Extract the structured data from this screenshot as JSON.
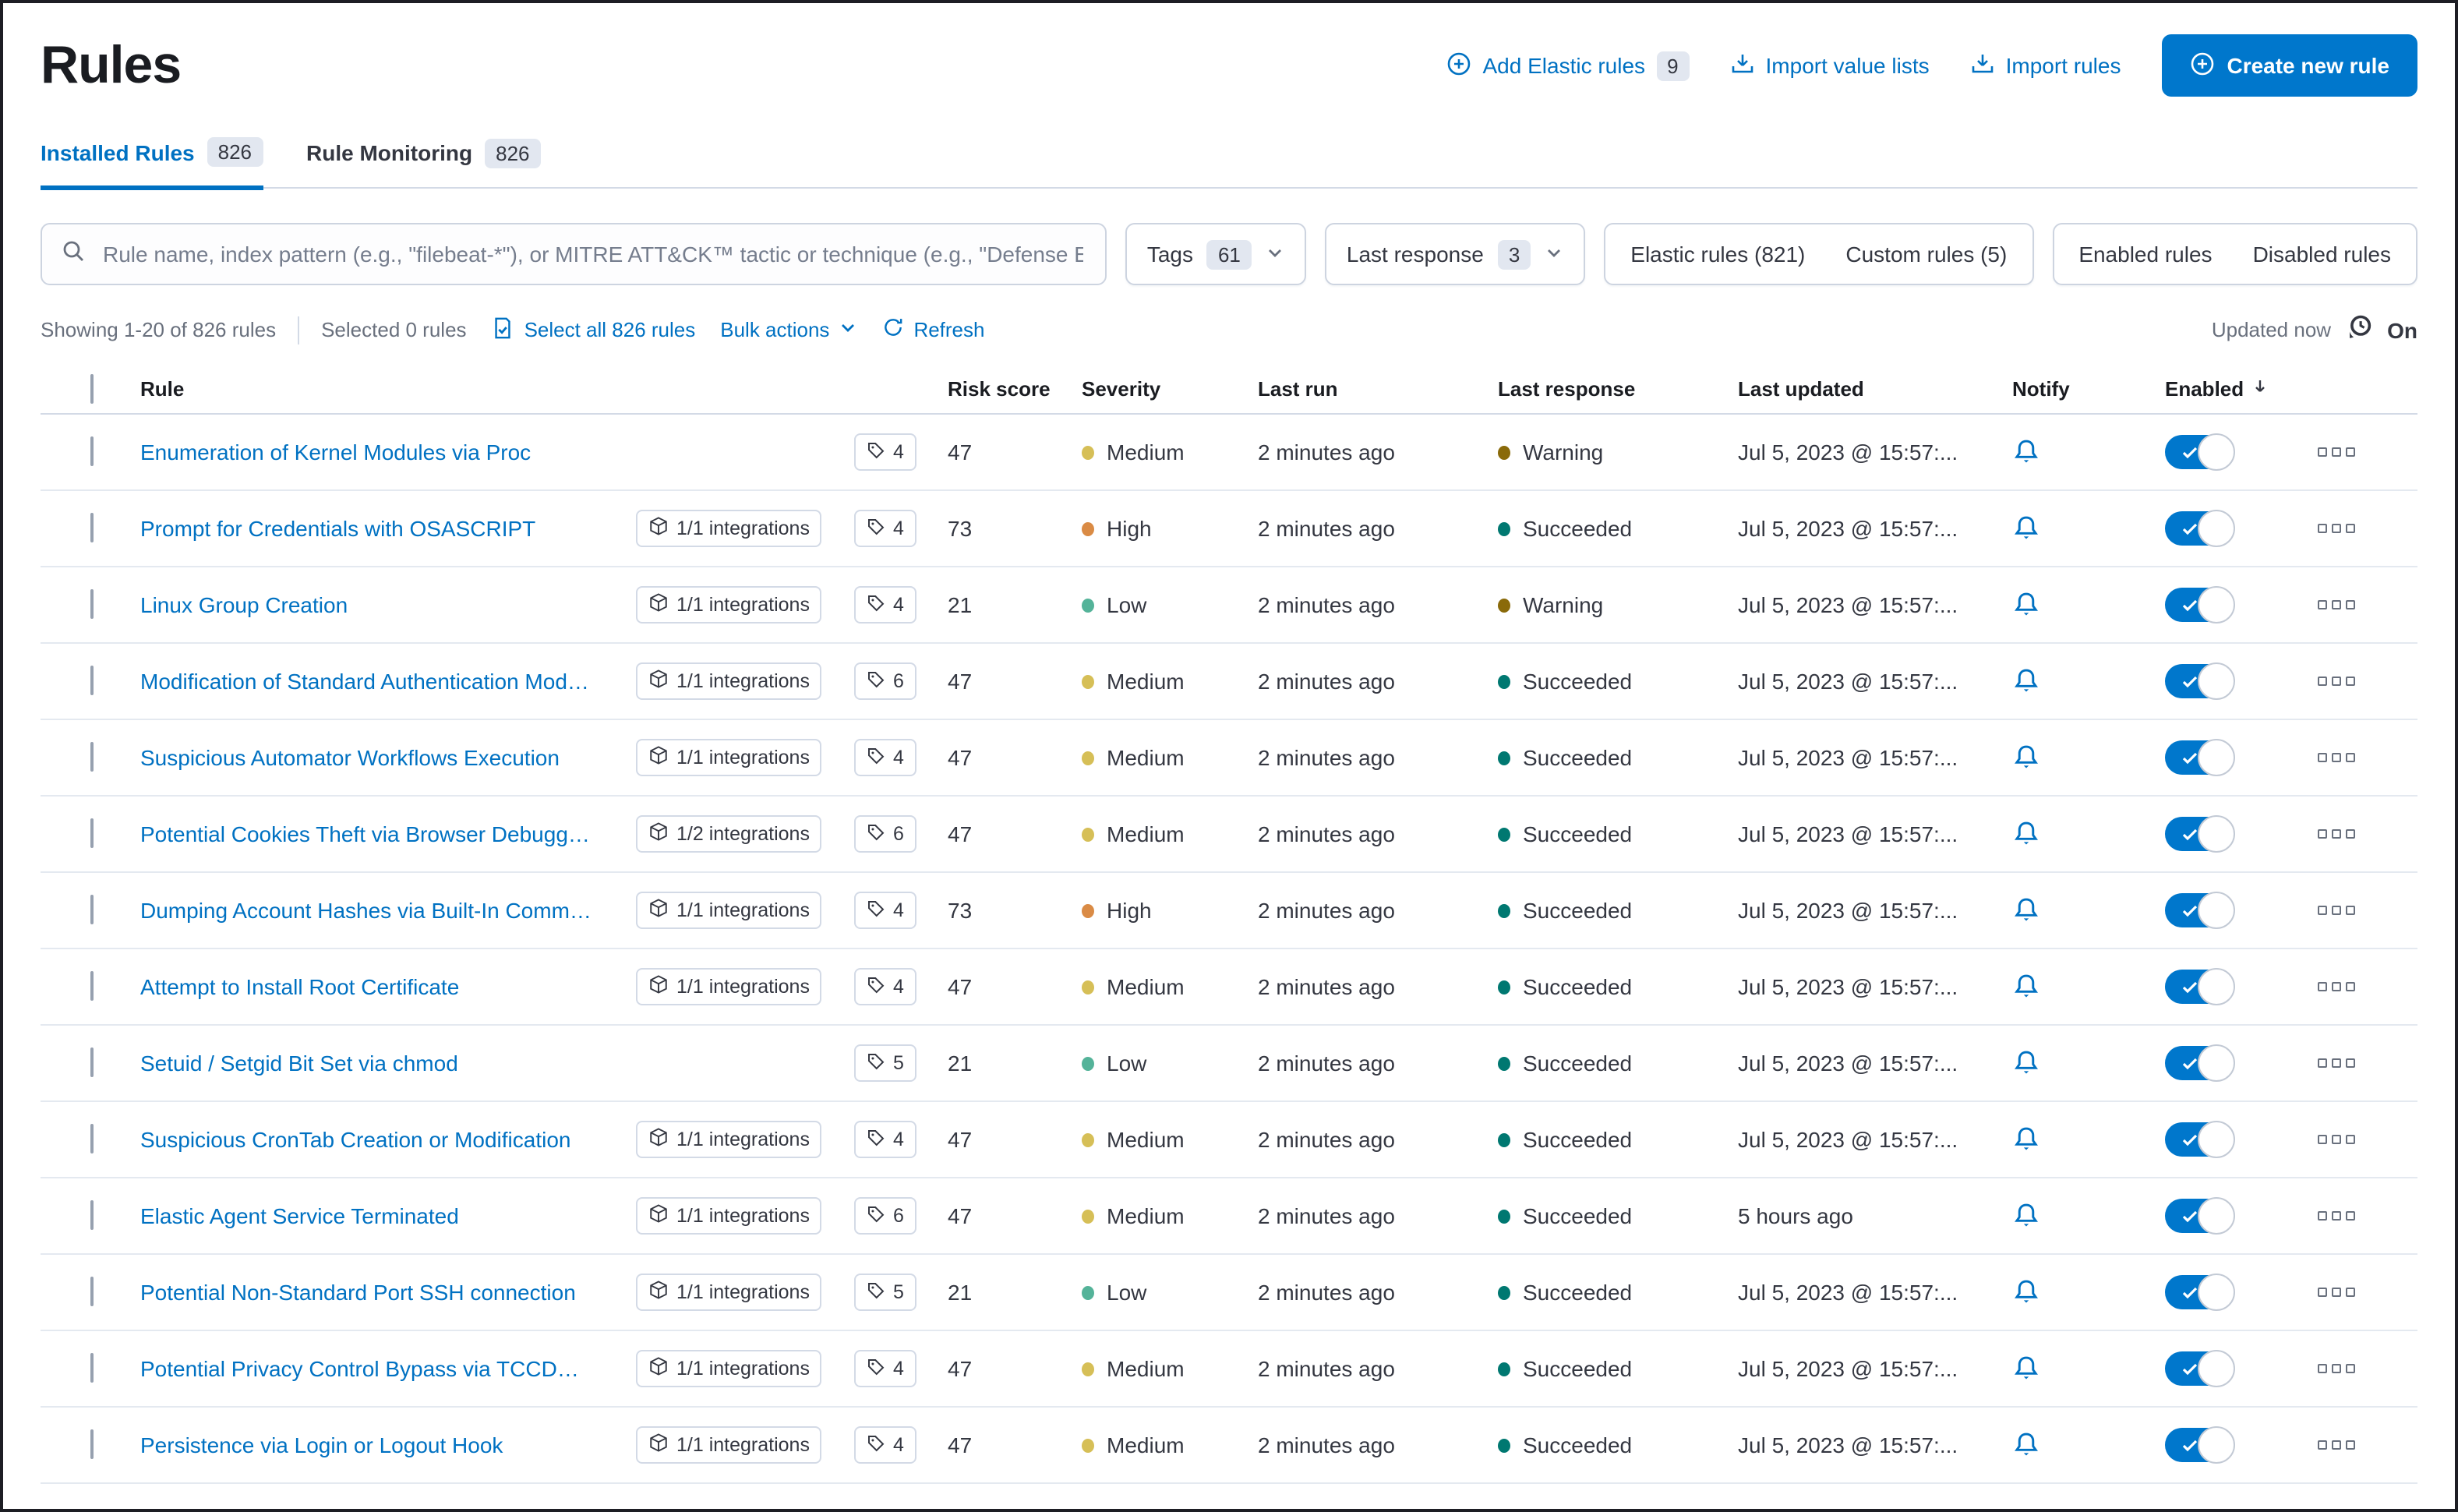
{
  "page": {
    "title": "Rules"
  },
  "header_actions": {
    "add_elastic_rules": "Add Elastic rules",
    "add_elastic_rules_badge": "9",
    "import_value_lists": "Import value lists",
    "import_rules": "Import rules",
    "create_new_rule": "Create new rule"
  },
  "tabs": [
    {
      "label": "Installed Rules",
      "badge": "826"
    },
    {
      "label": "Rule Monitoring",
      "badge": "826"
    }
  ],
  "search": {
    "placeholder": "Rule name, index pattern (e.g., \"filebeat-*\"), or MITRE ATT&CK™ tactic or technique (e.g., \"Defense Ev"
  },
  "filters": {
    "tags_label": "Tags",
    "tags_count": "61",
    "last_response_label": "Last response",
    "last_response_count": "3",
    "elastic_rules": "Elastic rules (821)",
    "custom_rules": "Custom rules (5)",
    "enabled_rules": "Enabled rules",
    "disabled_rules": "Disabled rules"
  },
  "utility": {
    "showing": "Showing 1-20 of 826 rules",
    "selected": "Selected 0 rules",
    "select_all": "Select all 826 rules",
    "bulk_actions": "Bulk actions",
    "refresh": "Refresh",
    "updated": "Updated now",
    "auto_refresh": "On"
  },
  "colors": {
    "severity": {
      "Low": "#54B399",
      "Medium": "#D6BF57",
      "High": "#DA8B45"
    },
    "response": {
      "Succeeded": "#007871",
      "Warning": "#8A6A0A"
    },
    "link": "#0071C2",
    "primary_button": "#0077CC"
  },
  "table": {
    "columns": [
      "Rule",
      "Risk score",
      "Severity",
      "Last run",
      "Last response",
      "Last updated",
      "Notify",
      "Enabled"
    ],
    "rows": [
      {
        "name": "Enumeration of Kernel Modules via Proc",
        "integrations": null,
        "tags": "4",
        "risk": "47",
        "severity": "Medium",
        "last_run": "2 minutes ago",
        "last_response": "Warning",
        "last_updated": "Jul 5, 2023 @ 15:57:..."
      },
      {
        "name": "Prompt for Credentials with OSASCRIPT",
        "integrations": "1/1 integrations",
        "tags": "4",
        "risk": "73",
        "severity": "High",
        "last_run": "2 minutes ago",
        "last_response": "Succeeded",
        "last_updated": "Jul 5, 2023 @ 15:57:..."
      },
      {
        "name": "Linux Group Creation",
        "integrations": "1/1 integrations",
        "tags": "4",
        "risk": "21",
        "severity": "Low",
        "last_run": "2 minutes ago",
        "last_response": "Warning",
        "last_updated": "Jul 5, 2023 @ 15:57:..."
      },
      {
        "name": "Modification of Standard Authentication Module or...",
        "integrations": "1/1 integrations",
        "tags": "6",
        "risk": "47",
        "severity": "Medium",
        "last_run": "2 minutes ago",
        "last_response": "Succeeded",
        "last_updated": "Jul 5, 2023 @ 15:57:..."
      },
      {
        "name": "Suspicious Automator Workflows Execution",
        "integrations": "1/1 integrations",
        "tags": "4",
        "risk": "47",
        "severity": "Medium",
        "last_run": "2 minutes ago",
        "last_response": "Succeeded",
        "last_updated": "Jul 5, 2023 @ 15:57:..."
      },
      {
        "name": "Potential Cookies Theft via Browser Debugging",
        "integrations": "1/2 integrations",
        "tags": "6",
        "risk": "47",
        "severity": "Medium",
        "last_run": "2 minutes ago",
        "last_response": "Succeeded",
        "last_updated": "Jul 5, 2023 @ 15:57:..."
      },
      {
        "name": "Dumping Account Hashes via Built-In Commands",
        "integrations": "1/1 integrations",
        "tags": "4",
        "risk": "73",
        "severity": "High",
        "last_run": "2 minutes ago",
        "last_response": "Succeeded",
        "last_updated": "Jul 5, 2023 @ 15:57:..."
      },
      {
        "name": "Attempt to Install Root Certificate",
        "integrations": "1/1 integrations",
        "tags": "4",
        "risk": "47",
        "severity": "Medium",
        "last_run": "2 minutes ago",
        "last_response": "Succeeded",
        "last_updated": "Jul 5, 2023 @ 15:57:..."
      },
      {
        "name": "Setuid / Setgid Bit Set via chmod",
        "integrations": null,
        "tags": "5",
        "risk": "21",
        "severity": "Low",
        "last_run": "2 minutes ago",
        "last_response": "Succeeded",
        "last_updated": "Jul 5, 2023 @ 15:57:..."
      },
      {
        "name": "Suspicious CronTab Creation or Modification",
        "integrations": "1/1 integrations",
        "tags": "4",
        "risk": "47",
        "severity": "Medium",
        "last_run": "2 minutes ago",
        "last_response": "Succeeded",
        "last_updated": "Jul 5, 2023 @ 15:57:..."
      },
      {
        "name": "Elastic Agent Service Terminated",
        "integrations": "1/1 integrations",
        "tags": "6",
        "risk": "47",
        "severity": "Medium",
        "last_run": "2 minutes ago",
        "last_response": "Succeeded",
        "last_updated": "5 hours ago"
      },
      {
        "name": "Potential Non-Standard Port SSH connection",
        "integrations": "1/1 integrations",
        "tags": "5",
        "risk": "21",
        "severity": "Low",
        "last_run": "2 minutes ago",
        "last_response": "Succeeded",
        "last_updated": "Jul 5, 2023 @ 15:57:..."
      },
      {
        "name": "Potential Privacy Control Bypass via TCCDB Modifi...",
        "integrations": "1/1 integrations",
        "tags": "4",
        "risk": "47",
        "severity": "Medium",
        "last_run": "2 minutes ago",
        "last_response": "Succeeded",
        "last_updated": "Jul 5, 2023 @ 15:57:..."
      },
      {
        "name": "Persistence via Login or Logout Hook",
        "integrations": "1/1 integrations",
        "tags": "4",
        "risk": "47",
        "severity": "Medium",
        "last_run": "2 minutes ago",
        "last_response": "Succeeded",
        "last_updated": "Jul 5, 2023 @ 15:57:..."
      }
    ]
  }
}
